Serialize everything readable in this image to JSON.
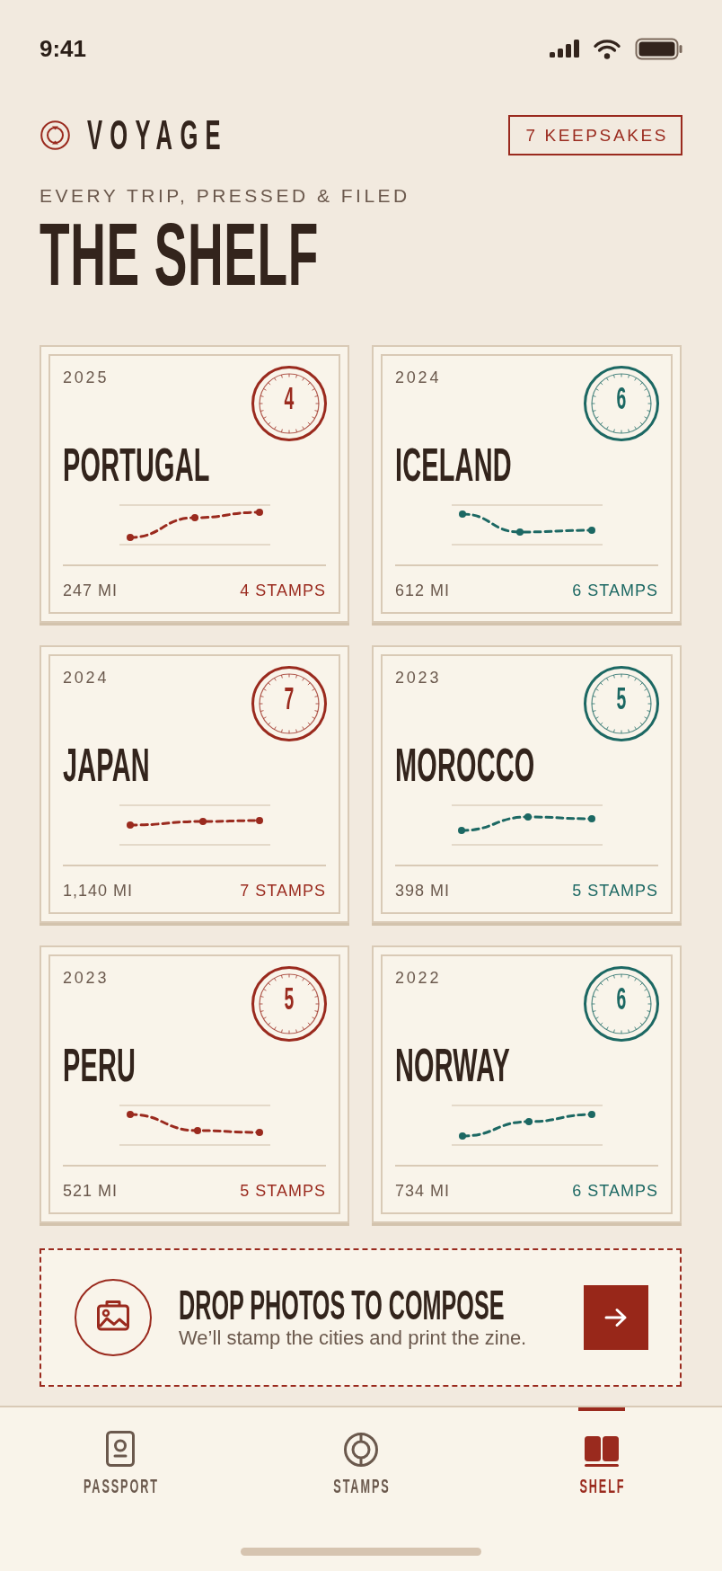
{
  "status_bar": {
    "time": "9:41"
  },
  "header": {
    "brand": "VOYAGE",
    "keepsakes": "7 KEEPSAKES",
    "eyebrow": "EVERY TRIP, PRESSED & FILED",
    "title": "THE SHELF"
  },
  "cards": [
    {
      "year": "2025",
      "stamp": "4",
      "country": "PORTUGAL",
      "distance": "247 MI",
      "stamps": "4 STAMPS",
      "color": "#9a2a1e"
    },
    {
      "year": "2024",
      "stamp": "6",
      "country": "ICELAND",
      "distance": "612 MI",
      "stamps": "6 STAMPS",
      "color": "#1c6863"
    },
    {
      "year": "2024",
      "stamp": "7",
      "country": "JAPAN",
      "distance": "1,140 MI",
      "stamps": "7 STAMPS",
      "color": "#9a2a1e"
    },
    {
      "year": "2023",
      "stamp": "5",
      "country": "MOROCCO",
      "distance": "398 MI",
      "stamps": "5 STAMPS",
      "color": "#1c6863"
    },
    {
      "year": "2023",
      "stamp": "5",
      "country": "PERU",
      "distance": "521 MI",
      "stamps": "5 STAMPS",
      "color": "#9a2a1e"
    },
    {
      "year": "2022",
      "stamp": "6",
      "country": "NORWAY",
      "distance": "734 MI",
      "stamps": "6 STAMPS",
      "color": "#1c6863"
    }
  ],
  "dropzone": {
    "title": "DROP PHOTOS TO COMPOSE",
    "hint": "We’ll stamp the cities and print the zine."
  },
  "tab_bar": {
    "tabs": [
      {
        "label": "PASSPORT",
        "kind": "passport",
        "selected": false
      },
      {
        "label": "STAMPS",
        "kind": "stamps",
        "selected": false
      },
      {
        "label": "SHELF",
        "kind": "shelf",
        "selected": true
      }
    ]
  }
}
